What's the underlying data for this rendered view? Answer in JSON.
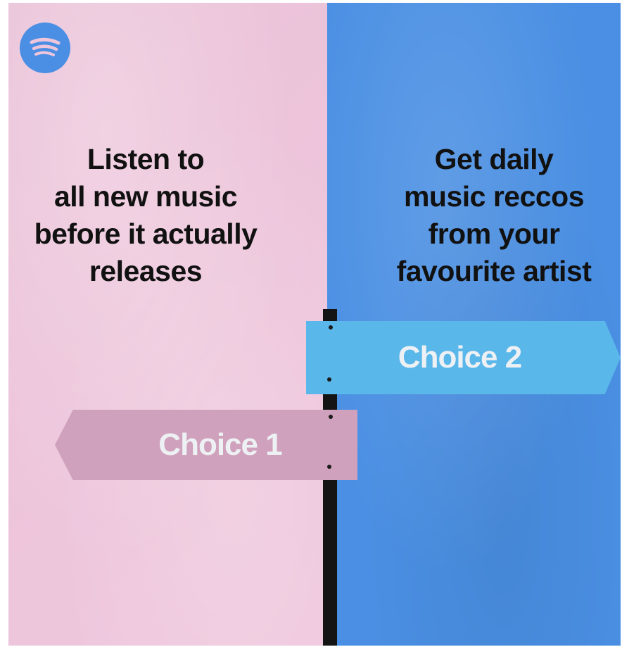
{
  "brand": {
    "logo_icon": "spotify-logo-icon",
    "logo_color": "#4a8fe3"
  },
  "left_option": {
    "lines": [
      "Listen to",
      "all new music",
      "before it actually",
      "releases"
    ],
    "sign_label": "Choice 1",
    "background_color": "#efc5dc",
    "sign_color": "#cfa1bc"
  },
  "right_option": {
    "lines": [
      "Get daily",
      "music reccos",
      "from your",
      "favourite artist"
    ],
    "sign_label": "Choice 2",
    "background_color": "#4a8fe3",
    "sign_color": "#5ab7ea"
  },
  "colors": {
    "text": "#111111",
    "sign_text": "#eef1f4",
    "post": "#141414"
  }
}
